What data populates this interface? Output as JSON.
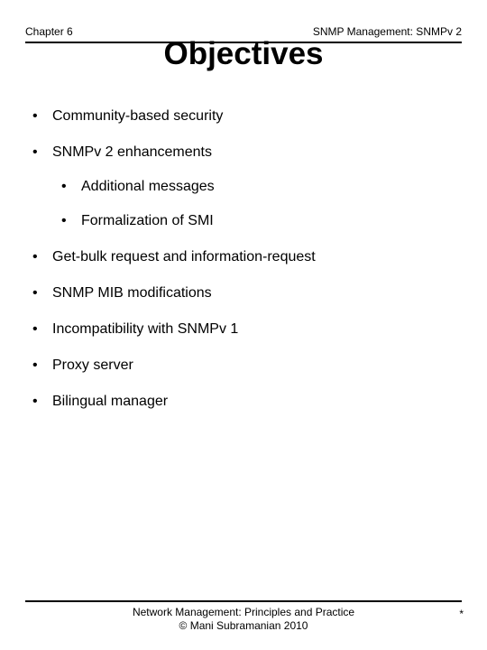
{
  "header": {
    "left": "Chapter 6",
    "right": "SNMP Management: SNMPv 2"
  },
  "title": "Objectives",
  "bullets": {
    "b0": "Community-based security",
    "b1": "SNMPv 2 enhancements",
    "b1_sub": {
      "s0": "Additional messages",
      "s1": "Formalization of SMI"
    },
    "b2": "Get-bulk request and information-request",
    "b3": "SNMP MIB modifications",
    "b4": "Incompatibility with SNMPv 1",
    "b5": "Proxy server",
    "b6": "Bilingual manager"
  },
  "footer": {
    "line1": "Network Management: Principles and Practice",
    "line2": "©  Mani Subramanian 2010",
    "pagemark": "*"
  }
}
